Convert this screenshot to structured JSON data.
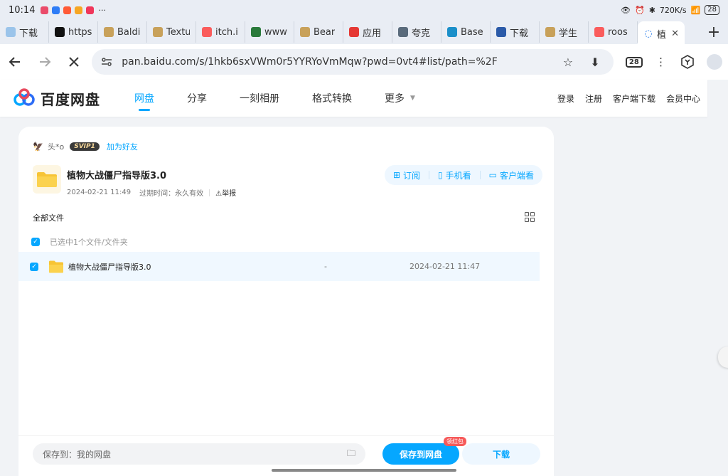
{
  "status": {
    "time": "10:14",
    "net_speed": "720K/s",
    "battery": "28",
    "app_dot_colors": [
      "#ea4b6a",
      "#2e7cf6",
      "#ff5a36",
      "#f6a623",
      "#f0365a"
    ],
    "more": "···"
  },
  "tabs": [
    {
      "label": "下载",
      "icon": "doc-icon",
      "color": "#9bc4ea"
    },
    {
      "label": "https",
      "icon": "x-logo-icon",
      "color": "#111111"
    },
    {
      "label": "Baldi",
      "icon": "godot-icon",
      "color": "#c8a15a"
    },
    {
      "label": "Textu",
      "icon": "godot-icon",
      "color": "#c8a15a"
    },
    {
      "label": "itch.i",
      "icon": "itch-icon",
      "color": "#fa5c5c"
    },
    {
      "label": "www",
      "icon": "stripe-icon",
      "color": "#2a7a3b"
    },
    {
      "label": "Bear",
      "icon": "godot-icon",
      "color": "#c8a15a"
    },
    {
      "label": "应用",
      "icon": "app-icon",
      "color": "#e53935"
    },
    {
      "label": "夸克",
      "icon": "cloud-icon",
      "color": "#5a6b7c"
    },
    {
      "label": "Base",
      "icon": "base-icon",
      "color": "#1b8fc9"
    },
    {
      "label": "下载",
      "icon": "download-icon",
      "color": "#2b5aa8"
    },
    {
      "label": "学生",
      "icon": "godot-icon",
      "color": "#c8a15a"
    },
    {
      "label": "roos",
      "icon": "itch-icon",
      "color": "#fa5c5c"
    },
    {
      "label": "植",
      "icon": "loading-icon",
      "color": "#1a73e8",
      "active": true
    }
  ],
  "omnibox": {
    "url": "pan.baidu.com/s/1hkb6sxVWm0r5YYRYoVmMqw?pwd=0vt4#list/path=%2F"
  },
  "toolbar": {
    "tab_count": "28"
  },
  "baidu": {
    "logo_text": "百度网盘",
    "nav": [
      "网盘",
      "分享",
      "一刻相册",
      "格式转换",
      "更多"
    ],
    "user_links": [
      "登录",
      "注册",
      "客户端下载",
      "会员中心"
    ]
  },
  "share": {
    "user": "头*o",
    "vip": "SVIP1",
    "add_friend": "加为好友",
    "title": "植物大战僵尸指导版3.0",
    "date": "2024-02-21 11:49",
    "expiry_label": "过期时间：",
    "expiry_value": "永久有效",
    "report": "举报",
    "actions": [
      "订阅",
      "手机看",
      "客户端看"
    ],
    "all_files": "全部文件",
    "selected_text": "已选中1个文件/文件夹",
    "files": [
      {
        "name": "植物大战僵尸指导版3.0",
        "size": "-",
        "date": "2024-02-21 11:47"
      }
    ],
    "save_path_label": "保存到：我的网盘",
    "save_button": "保存到网盘",
    "save_badge": "领红包",
    "download_button": "下载"
  }
}
